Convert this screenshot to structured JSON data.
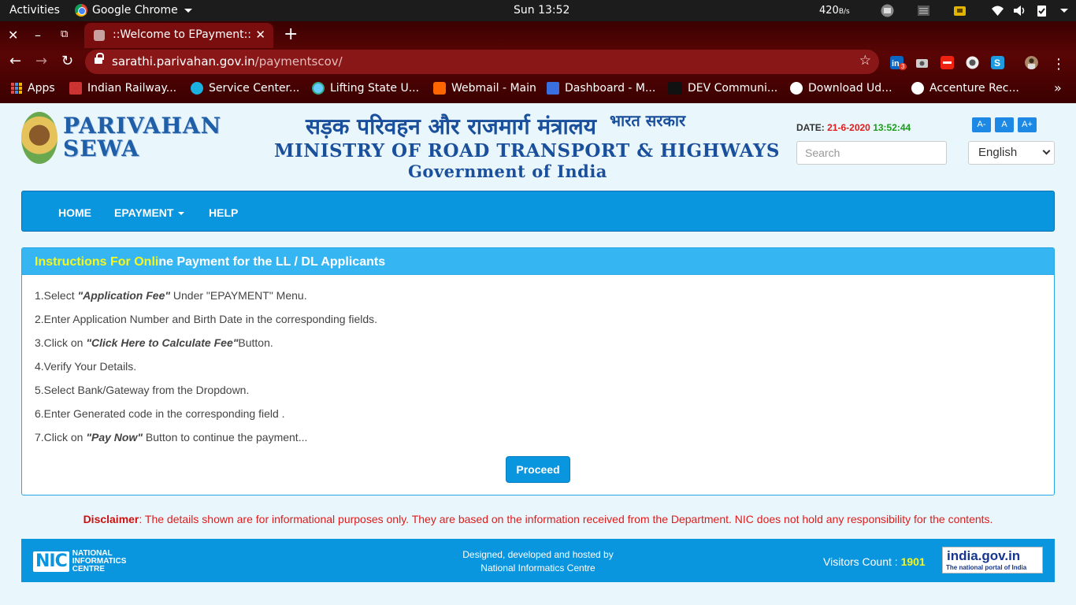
{
  "system": {
    "activities": "Activities",
    "app_name": "Google Chrome",
    "clock": "Sun 13:52",
    "net_speed": "420",
    "net_unit": "B/s"
  },
  "browser": {
    "tab_title": "::Welcome to EPayment::",
    "url_host": "sarathi.parivahan.gov.in",
    "url_path": "/paymentscov/",
    "extension_badge": "3",
    "bookmarks": [
      {
        "label": "Apps"
      },
      {
        "label": "Indian Railway..."
      },
      {
        "label": "Service Center..."
      },
      {
        "label": "Lifting State U..."
      },
      {
        "label": "Webmail - Main"
      },
      {
        "label": "Dashboard - M..."
      },
      {
        "label": "DEV Communi..."
      },
      {
        "label": "Download Ud..."
      },
      {
        "label": "Accenture Rec..."
      }
    ]
  },
  "header": {
    "logo_line1": "PARIVAHAN",
    "logo_line2": "SEWA",
    "ministry_hindi": "सड़क परिवहन और राजमार्ग मंत्रालय",
    "ministry_hindi_small": "भारत सरकार",
    "ministry_english": "MINISTRY OF ROAD TRANSPORT & HIGHWAYS",
    "government": "Government of India",
    "date_label": "DATE:",
    "date_value": "21-6-2020",
    "time_value": "13:52:44",
    "font_buttons": [
      "A-",
      "A",
      "A+"
    ],
    "search_placeholder": "Search",
    "language": "English"
  },
  "nav": {
    "home": "HOME",
    "epayment": "EPAYMENT",
    "help": "HELP"
  },
  "panel": {
    "title_highlight": "Instructions For Onli",
    "title_rest": "ne Payment for the LL / DL Applicants",
    "steps": {
      "s1_pre": "1.Select ",
      "s1_bold": "\"Application Fee\"",
      "s1_post": " Under \"EPAYMENT\" Menu.",
      "s2": "2.Enter Application Number and Birth Date in the corresponding fields.",
      "s3_pre": "3.Click on ",
      "s3_bold": "\"Click Here to Calculate Fee\"",
      "s3_post": "Button.",
      "s4": "4.Verify Your Details.",
      "s5": "5.Select Bank/Gateway from the Dropdown.",
      "s6": "6.Enter Generated code in the corresponding field .",
      "s7_pre": "7.Click on ",
      "s7_bold": "\"Pay Now\"",
      "s7_post": " Button to continue the payment..."
    },
    "proceed": "Proceed"
  },
  "disclaimer": {
    "label": "Disclaimer",
    "text": ": The details shown are for informational purposes only. They are based on the information received from the Department. NIC does not hold any responsibility for the contents."
  },
  "footer": {
    "nic_mark": "NIC",
    "nic_line1": "NATIONAL",
    "nic_line2": "INFORMATICS",
    "nic_line3": "CENTRE",
    "credit_line1": "Designed, developed and hosted by",
    "credit_line2": "National Informatics Centre",
    "visitors_label": "Visitors Count : ",
    "visitors_count": "1901",
    "portal_name": "india.gov.in",
    "portal_tagline": "The national portal of India"
  },
  "colors": {
    "nav_blue": "#0a95df",
    "panel_header": "#35b6f2",
    "highlight_yellow": "#f7f71a",
    "disclaimer_red": "#e01b1b",
    "chrome_theme": "#5a0505"
  }
}
